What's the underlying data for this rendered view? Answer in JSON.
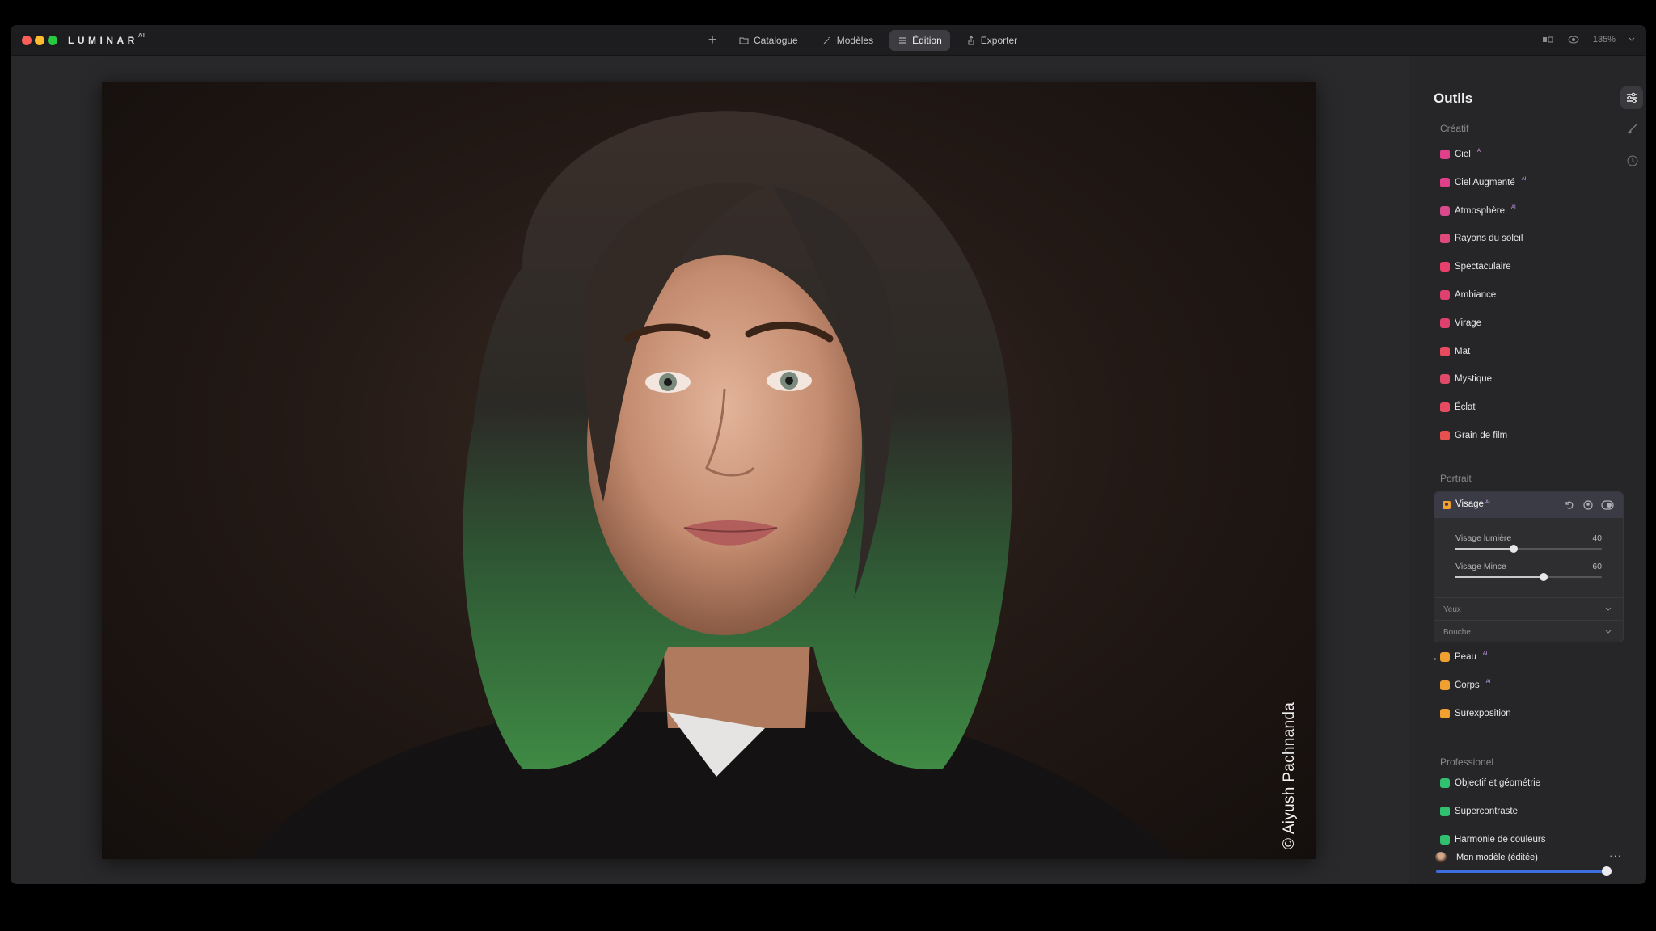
{
  "app": {
    "name": "LUMINAR",
    "name_sup": "AI"
  },
  "topnav": {
    "items": [
      {
        "label": "Catalogue",
        "icon": "folder-icon"
      },
      {
        "label": "Modèles",
        "icon": "wand-icon"
      },
      {
        "label": "Édition",
        "icon": "sliders-icon",
        "active": true
      },
      {
        "label": "Exporter",
        "icon": "share-icon"
      }
    ]
  },
  "topright": {
    "zoom": "135%"
  },
  "photo": {
    "watermark": "© Aiyush Pachnanda"
  },
  "sidebar": {
    "title": "Outils",
    "sections": {
      "creatif": "Créatif",
      "portrait": "Portrait",
      "professionel": "Professionel"
    },
    "creatif_tools": [
      {
        "label": "Ciel",
        "ai": "AI",
        "color": "#e0408a"
      },
      {
        "label": "Ciel Augmenté",
        "ai": "AI",
        "color": "#e0408a"
      },
      {
        "label": "Atmosphère",
        "ai": "AI",
        "color": "#d94a8c"
      },
      {
        "label": "Rayons du soleil",
        "ai": "",
        "color": "#e04a7a"
      },
      {
        "label": "Spectaculaire",
        "ai": "",
        "color": "#e8406a"
      },
      {
        "label": "Ambiance",
        "ai": "",
        "color": "#e0406e"
      },
      {
        "label": "Virage",
        "ai": "",
        "color": "#e0406e"
      },
      {
        "label": "Mat",
        "ai": "",
        "color": "#e84a5e"
      },
      {
        "label": "Mystique",
        "ai": "",
        "color": "#e04a6a"
      },
      {
        "label": "Éclat",
        "ai": "",
        "color": "#e84a62"
      },
      {
        "label": "Grain de film",
        "ai": "",
        "color": "#e85050"
      }
    ],
    "visage": {
      "title": "Visage",
      "ai": "AI",
      "sliders": [
        {
          "label": "Visage lumière",
          "value": 40
        },
        {
          "label": "Visage Mince",
          "value": 60
        }
      ],
      "sub_rows": [
        "Yeux",
        "Bouche"
      ]
    },
    "portrait_tools": [
      {
        "label": "Peau",
        "ai": "AI",
        "color": "#f0a030"
      },
      {
        "label": "Corps",
        "ai": "AI",
        "color": "#f0a030"
      },
      {
        "label": "Surexposition",
        "ai": "",
        "color": "#f0a030"
      }
    ],
    "pro_tools": [
      {
        "label": "Objectif et géométrie",
        "ai": "",
        "color": "#30c070"
      },
      {
        "label": "Supercontraste",
        "ai": "",
        "color": "#30c070"
      },
      {
        "label": "Harmonie de couleurs",
        "ai": "",
        "color": "#30c070"
      }
    ],
    "model": {
      "label": "Mon modèle (éditée)",
      "more": "···",
      "amount": 100
    }
  }
}
